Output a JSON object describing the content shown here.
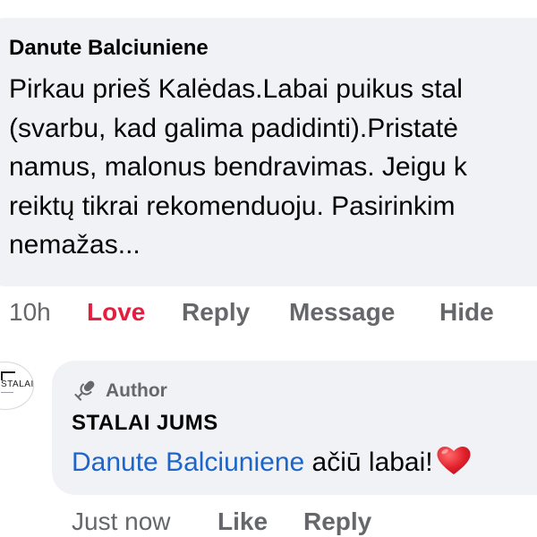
{
  "comment": {
    "author": "Danute Balciuniene",
    "text_lines": [
      "Pirkau prieš Kalėdas.Labai puikus stal",
      "(svarbu, kad galima padidinti).Pristatė",
      "namus, malonus bendravimas. Jeigu k",
      "reiktų tikrai rekomenduoju. Pasirinkim",
      "nemažas..."
    ],
    "actions": {
      "time": "10h",
      "reaction": "Love",
      "reply": "Reply",
      "message": "Message",
      "hide": "Hide"
    },
    "reaction_color": "#e41e3f"
  },
  "reply": {
    "avatar_text": "STALAI",
    "badge": "Author",
    "author": "STALAI JUMS",
    "mention": "Danute Balciuniene",
    "text": "ačiū labai!",
    "emoji": "heart-icon",
    "mention_color": "#1d65c9",
    "actions": {
      "time": "Just now",
      "like": "Like",
      "reply": "Reply"
    }
  }
}
